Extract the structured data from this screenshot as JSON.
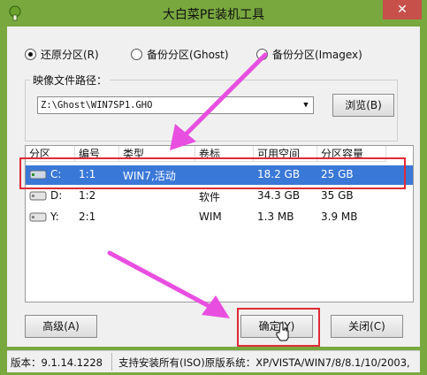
{
  "window": {
    "title": "大白菜PE装机工具",
    "close_glyph": "✕"
  },
  "modes": [
    {
      "label": "还原分区(R)",
      "checked": true
    },
    {
      "label": "备份分区(Ghost)",
      "checked": false
    },
    {
      "label": "备份分区(Imagex)",
      "checked": false
    }
  ],
  "image_path": {
    "label": "映像文件路径：",
    "value": "Z:\\Ghost\\WIN7SP1.GHO",
    "browse_label": "浏览(B)"
  },
  "partition_table": {
    "columns": [
      "分区",
      "编号",
      "类型",
      "卷标",
      "可用空间",
      "分区容量"
    ],
    "rows": [
      {
        "drive": "C:",
        "number": "1:1",
        "type": "WIN7,活动",
        "label": "",
        "free": "18.2 GB",
        "size": "25 GB",
        "selected": true
      },
      {
        "drive": "D:",
        "number": "1:2",
        "type": "",
        "label": "软件",
        "free": "34.3 GB",
        "size": "35 GB",
        "selected": false
      },
      {
        "drive": "Y:",
        "number": "2:1",
        "type": "",
        "label": "WIM",
        "free": "1.3 MB",
        "size": "3.9 MB",
        "selected": false
      }
    ]
  },
  "buttons": {
    "advanced": "高级(A)",
    "ok": "确定(Y)",
    "close": "关闭(C)"
  },
  "status": {
    "version": "版本：9.1.14.1228",
    "support": "支持安装所有(ISO)原版系统：XP/VISTA/WIN7/8/8.1/10/2003,"
  },
  "colors": {
    "window_frame": "#79a83f",
    "selection": "#3a78d8",
    "highlight_box": "#e02a36",
    "annotation_arrow": "#e84fe0"
  }
}
